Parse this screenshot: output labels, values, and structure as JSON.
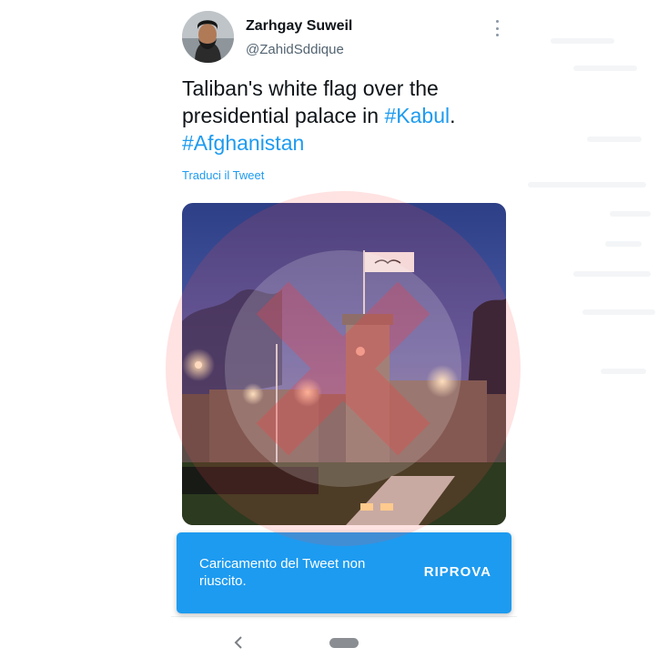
{
  "tweet": {
    "display_name": "Zarhgay Suweil",
    "handle": "@ZahidSddique",
    "text_plain_1": "Taliban's white flag over the presidential palace in ",
    "hashtag_1": "#Kabul",
    "text_plain_2": ".",
    "hashtag_2": "#Afghanistan",
    "translate_label": "Traduci il Tweet",
    "more_icon": "more-vertical-icon"
  },
  "snackbar": {
    "message": "Caricamento del Tweet non riuscito.",
    "action_label": "RIPROVA",
    "color": "#1d9bf0"
  },
  "system_nav": {
    "back_icon": "chevron-left-icon",
    "home_icon": "home-pill-icon"
  },
  "colors": {
    "link": "#1d9bf0",
    "text": "#0f1419",
    "secondary_text": "#536471"
  }
}
